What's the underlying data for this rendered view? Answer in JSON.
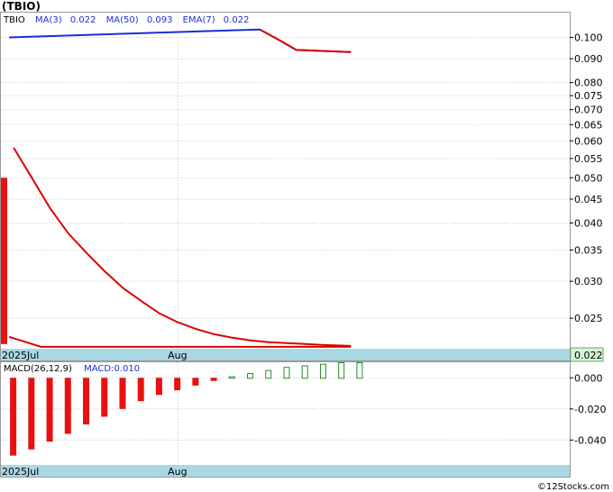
{
  "title": "(TBIO)",
  "watermark": "©12Stocks.com",
  "colors": {
    "ma50": "#1a2fd4",
    "ma3": "#e00000",
    "bar": "#ee1111",
    "hist_pos": "#2a8a2a",
    "hist_neg": "#e81010",
    "date_strip": "#a9d8e4",
    "last_price_box": "#d3f5d3",
    "grid": "#c8c8c8"
  },
  "chart_data": [
    {
      "type": "line",
      "legend": {
        "ticker": "TBIO",
        "ma3_label": "MA(3)",
        "ma3_value": "0.022",
        "ma50_label": "MA(50)",
        "ma50_value": "0.093",
        "ema_label": "EMA(7)",
        "ema_value": "0.022"
      },
      "y_scale": "log",
      "y_ticks": [
        "0.100",
        "0.090",
        "0.080",
        "0.075",
        "0.070",
        "0.065",
        "0.060",
        "0.055",
        "0.050",
        "0.045",
        "0.040",
        "0.035",
        "0.030",
        "0.025"
      ],
      "ylim": [
        0.0215,
        0.113
      ],
      "x_labels": [
        {
          "text": "2025Jul",
          "x": 1
        },
        {
          "text": "Aug",
          "x": 19
        }
      ],
      "xlim": [
        0,
        62
      ],
      "last_price": "0.022",
      "price_bars": [
        {
          "x": 0.5,
          "high": 0.05,
          "low": 0.022
        }
      ],
      "series": [
        {
          "key": "ma50",
          "points": [
            [
              0.5,
              0.1
            ],
            [
              28,
              0.104
            ],
            [
              30,
              0.099
            ],
            [
              32,
              0.094
            ],
            [
              38,
              0.093
            ]
          ]
        },
        {
          "key": "ema7",
          "points": [
            [
              1,
              0.058
            ],
            [
              3,
              0.05
            ],
            [
              5,
              0.043
            ],
            [
              7,
              0.038
            ],
            [
              9,
              0.0345
            ],
            [
              11,
              0.0315
            ],
            [
              13,
              0.029
            ],
            [
              15,
              0.0272
            ],
            [
              17,
              0.0256
            ],
            [
              19,
              0.0245
            ],
            [
              21,
              0.0237
            ],
            [
              23,
              0.0231
            ],
            [
              25,
              0.0227
            ],
            [
              27,
              0.0224
            ],
            [
              29,
              0.0222
            ],
            [
              31,
              0.0221
            ],
            [
              33,
              0.022
            ],
            [
              35,
              0.0219
            ],
            [
              38,
              0.0218
            ]
          ]
        },
        {
          "key": "ma3",
          "points": [
            [
              0.5,
              0.0228
            ],
            [
              4,
              0.0217
            ],
            [
              38,
              0.0217
            ]
          ]
        }
      ]
    },
    {
      "type": "bar",
      "legend": {
        "label": "MACD(26,12,9)",
        "value_label": "MACD:0.010"
      },
      "y_ticks": [
        "0.000",
        "-0.020",
        "-0.040"
      ],
      "ylim": [
        -0.056,
        0.01
      ],
      "x_labels": [
        {
          "text": "2025Jul",
          "x": 1
        },
        {
          "text": "Aug",
          "x": 19
        }
      ],
      "xlim": [
        0,
        62
      ],
      "histogram": [
        {
          "x": 1,
          "value": -0.05
        },
        {
          "x": 3,
          "value": -0.046
        },
        {
          "x": 5,
          "value": -0.041
        },
        {
          "x": 7,
          "value": -0.036
        },
        {
          "x": 9,
          "value": -0.03
        },
        {
          "x": 11,
          "value": -0.025
        },
        {
          "x": 13,
          "value": -0.02
        },
        {
          "x": 15,
          "value": -0.015
        },
        {
          "x": 17,
          "value": -0.011
        },
        {
          "x": 19,
          "value": -0.008
        },
        {
          "x": 21,
          "value": -0.005
        },
        {
          "x": 23,
          "value": -0.002
        },
        {
          "x": 25,
          "value": 0.001
        },
        {
          "x": 27,
          "value": 0.003
        },
        {
          "x": 29,
          "value": 0.005
        },
        {
          "x": 31,
          "value": 0.007
        },
        {
          "x": 33,
          "value": 0.008
        },
        {
          "x": 35,
          "value": 0.009
        },
        {
          "x": 37,
          "value": 0.01
        },
        {
          "x": 39,
          "value": 0.01
        }
      ]
    }
  ]
}
